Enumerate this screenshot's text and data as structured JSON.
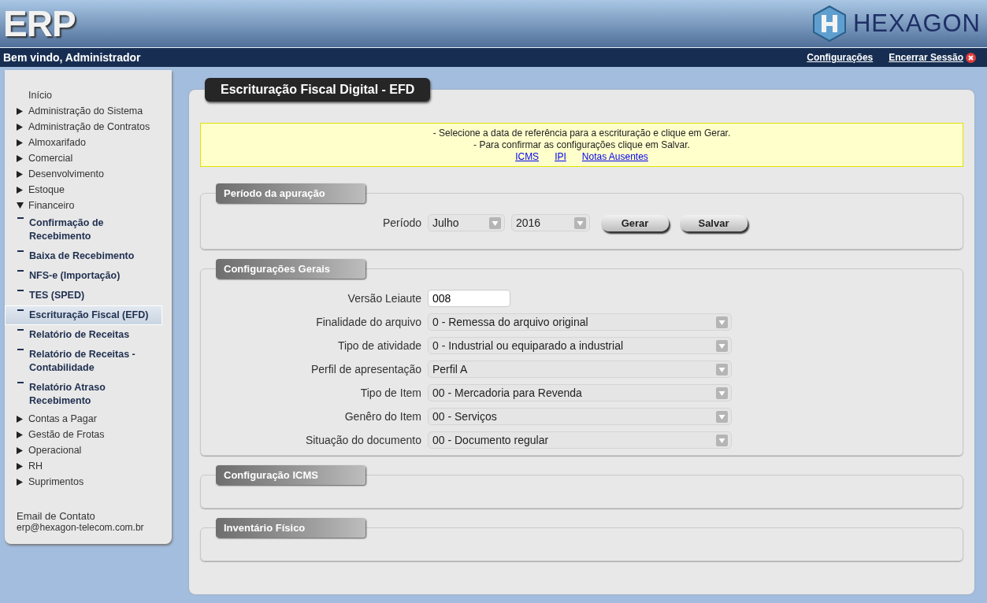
{
  "header": {
    "app_title": "ERP",
    "logo_text": "HEXAGON"
  },
  "top_bar": {
    "welcome": "Bem vindo, Administrador",
    "links": [
      {
        "label": "Configurações",
        "kind": "plain"
      },
      {
        "label": "Encerrar Sessão",
        "kind": "logout"
      }
    ]
  },
  "sidebar": {
    "items": [
      {
        "label": "Início",
        "kind": "link"
      },
      {
        "label": "Administração do Sistema",
        "kind": "group",
        "expanded": false
      },
      {
        "label": "Administração de Contratos",
        "kind": "group",
        "expanded": false
      },
      {
        "label": "Almoxarifado",
        "kind": "group",
        "expanded": false
      },
      {
        "label": "Comercial",
        "kind": "group",
        "expanded": false
      },
      {
        "label": "Desenvolvimento",
        "kind": "group",
        "expanded": false
      },
      {
        "label": "Estoque",
        "kind": "group",
        "expanded": false
      },
      {
        "label": "Financeiro",
        "kind": "group",
        "expanded": true,
        "children": [
          {
            "label": "Confirmação de Recebimento",
            "selected": false
          },
          {
            "label": "Baixa de Recebimento",
            "selected": false
          },
          {
            "label": "NFS-e (Importação)",
            "selected": false
          },
          {
            "label": "TES (SPED)",
            "selected": false
          },
          {
            "label": "Escrituração Fiscal (EFD)",
            "selected": true
          },
          {
            "label": "Relatório de Receitas",
            "selected": false
          },
          {
            "label": "Relatório de Receitas - Contabilidade",
            "selected": false
          },
          {
            "label": "Relatório Atraso Recebimento",
            "selected": false
          }
        ]
      },
      {
        "label": "Contas a Pagar",
        "kind": "group",
        "expanded": false
      },
      {
        "label": "Gestão de Frotas",
        "kind": "group",
        "expanded": false
      },
      {
        "label": "Operacional",
        "kind": "group",
        "expanded": false
      },
      {
        "label": "RH",
        "kind": "group",
        "expanded": false
      },
      {
        "label": "Suprimentos",
        "kind": "group",
        "expanded": false
      }
    ],
    "contact_label": "Email de Contato",
    "contact_email": "erp@hexagon-telecom.com.br"
  },
  "page": {
    "title": "Escrituração Fiscal Digital - EFD",
    "notice": {
      "lines": [
        "- Selecione a data de referência para a escrituração e clique em Gerar.",
        "- Para confirmar as configurações clique em Salvar."
      ],
      "links": [
        "ICMS",
        "IPI",
        "Notas Ausentes"
      ]
    },
    "sections": [
      {
        "title": "Período da apuração",
        "kind": "period",
        "label": "Período",
        "selects": [
          "Julho",
          "2016"
        ],
        "buttons": [
          "Gerar",
          "Salvar"
        ]
      },
      {
        "title": "Configurações Gerais",
        "kind": "form",
        "fields": [
          {
            "label": "Versão Leiaute",
            "kind": "input",
            "value": "008"
          },
          {
            "label": "Finalidade do arquivo",
            "kind": "select",
            "value": "0 - Remessa do arquivo original"
          },
          {
            "label": "Tipo de atividade",
            "kind": "select",
            "value": "0 - Industrial ou equiparado a industrial"
          },
          {
            "label": "Perfil de apresentação",
            "kind": "select",
            "value": "Perfil A"
          },
          {
            "label": "Tipo de Item",
            "kind": "select",
            "value": "00 - Mercadoria para Revenda"
          },
          {
            "label": "Genêro do Item",
            "kind": "select",
            "value": "00 - Serviços"
          },
          {
            "label": "Situação do documento",
            "kind": "select",
            "value": "00 - Documento regular"
          }
        ]
      },
      {
        "title": "Configuração ICMS",
        "kind": "empty"
      },
      {
        "title": "Inventário Físico",
        "kind": "empty"
      }
    ]
  }
}
